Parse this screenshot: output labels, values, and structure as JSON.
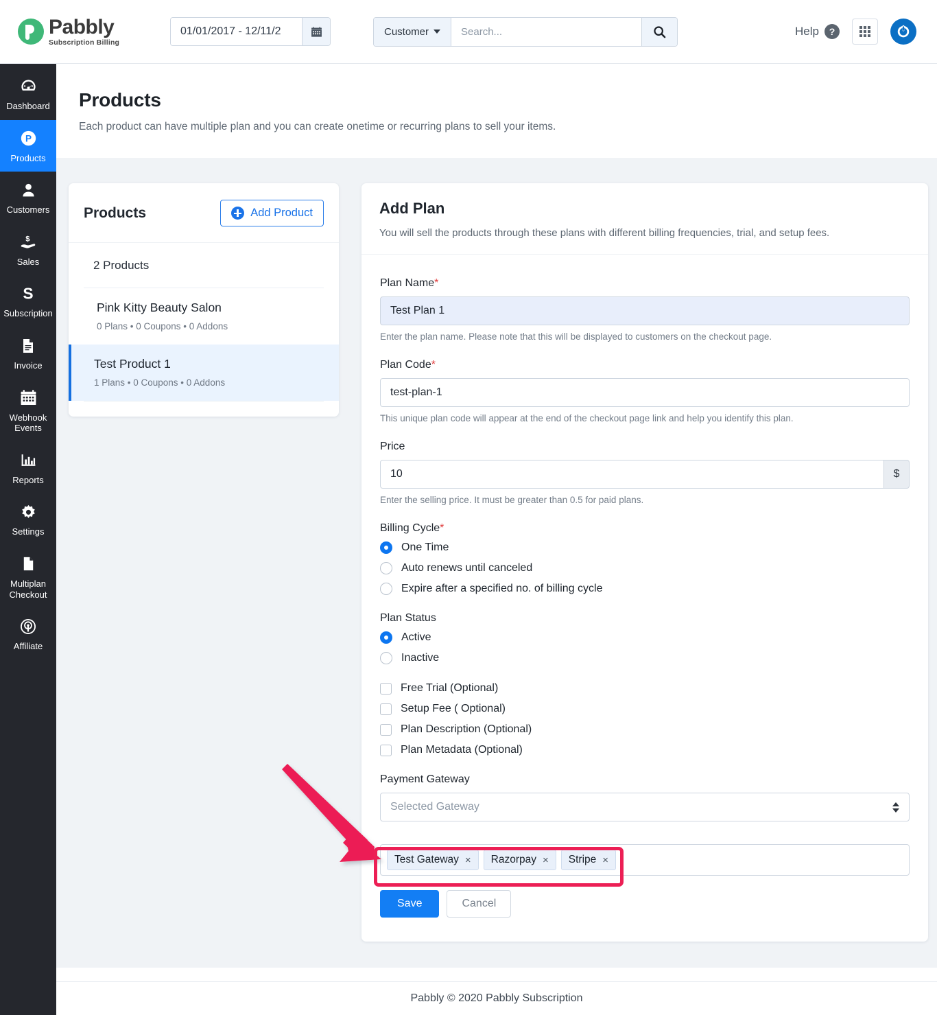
{
  "topbar": {
    "logo": {
      "title": "Pabbly",
      "subtitle": "Subscription Billing",
      "color": "#3fb878"
    },
    "date_range": {
      "value": "01/01/2017 - 12/11/2",
      "icon": "calendar-icon"
    },
    "search": {
      "scope_label": "Customer",
      "placeholder": "Search...",
      "value": "",
      "icon": "search-icon"
    },
    "help_label": "Help",
    "icons": {
      "help": "help-circle-icon",
      "apps": "apps-grid-icon",
      "account": "power-account-icon"
    }
  },
  "sidebar": {
    "items": [
      {
        "label": "Dashboard",
        "icon": "speedometer-icon",
        "active": false
      },
      {
        "label": "Products",
        "icon": "pabbly-p-icon",
        "active": true
      },
      {
        "label": "Customers",
        "icon": "user-icon",
        "active": false
      },
      {
        "label": "Sales",
        "icon": "hand-money-icon",
        "active": false
      },
      {
        "label": "Subscription",
        "icon": "letter-s-icon",
        "active": false
      },
      {
        "label": "Invoice",
        "icon": "document-lines-icon",
        "active": false
      },
      {
        "label": "Webhook Events",
        "icon": "calendar-icon",
        "active": false
      },
      {
        "label": "Reports",
        "icon": "bar-chart-icon",
        "active": false
      },
      {
        "label": "Settings",
        "icon": "gear-icon",
        "active": false
      },
      {
        "label": "Multiplan Checkout",
        "icon": "page-icon",
        "active": false
      },
      {
        "label": "Affiliate",
        "icon": "broadcast-icon",
        "active": false
      }
    ],
    "active_color": "#1481ff",
    "bg_color": "#25272d"
  },
  "page": {
    "title": "Products",
    "subtitle": "Each product can have multiple plan and you can create onetime or recurring plans to sell your items."
  },
  "products_panel": {
    "title": "Products",
    "add_button": "Add Product",
    "add_icon": "plus-circle-icon",
    "count_label": "2 Products",
    "items": [
      {
        "name": "Pink Kitty Beauty Salon",
        "meta": "0 Plans  • 0 Coupons  • 0 Addons",
        "selected": false
      },
      {
        "name": "Test Product 1",
        "meta": "1 Plans  • 0 Coupons  • 0 Addons",
        "selected": true
      }
    ]
  },
  "add_plan": {
    "title": "Add Plan",
    "subtitle": "You will sell the products through these plans with different billing frequencies, trial, and setup fees.",
    "plan_name": {
      "label": "Plan Name",
      "required": "*",
      "value": "Test Plan 1",
      "hint": "Enter the plan name. Please note that this will be displayed to customers on the checkout page."
    },
    "plan_code": {
      "label": "Plan Code",
      "required": "*",
      "value": "test-plan-1",
      "hint": "This unique plan code will appear at the end of the checkout page link and help you identify this plan."
    },
    "price": {
      "label": "Price",
      "value": "10",
      "currency": "$",
      "hint": "Enter the selling price. It must be greater than 0.5 for paid plans."
    },
    "billing_cycle": {
      "label": "Billing Cycle",
      "required": "*",
      "options": [
        {
          "label": "One Time",
          "selected": true
        },
        {
          "label": "Auto renews until canceled",
          "selected": false
        },
        {
          "label": "Expire after a specified no. of billing cycle",
          "selected": false
        }
      ]
    },
    "plan_status": {
      "label": "Plan Status",
      "options": [
        {
          "label": "Active",
          "selected": true
        },
        {
          "label": "Inactive",
          "selected": false
        }
      ]
    },
    "optional_checkboxes": [
      {
        "label": "Free Trial (Optional)",
        "checked": false
      },
      {
        "label": "Setup Fee ( Optional)",
        "checked": false
      },
      {
        "label": "Plan Description (Optional)",
        "checked": false
      },
      {
        "label": "Plan Metadata (Optional)",
        "checked": false
      }
    ],
    "payment_gateway": {
      "label": "Payment Gateway",
      "select_placeholder": "Selected Gateway",
      "tags": [
        {
          "label": "Test Gateway",
          "remove": "×"
        },
        {
          "label": "Razorpay",
          "remove": "×"
        },
        {
          "label": "Stripe",
          "remove": "×"
        }
      ]
    },
    "save_label": "Save",
    "cancel_label": "Cancel"
  },
  "footer": {
    "text": "Pabbly © 2020 Pabbly Subscription"
  },
  "annotation": {
    "highlight_color": "#ec1f55",
    "arrow_icon": "red-arrow-pointing-down-right",
    "target": "payment-gateway-tags"
  }
}
